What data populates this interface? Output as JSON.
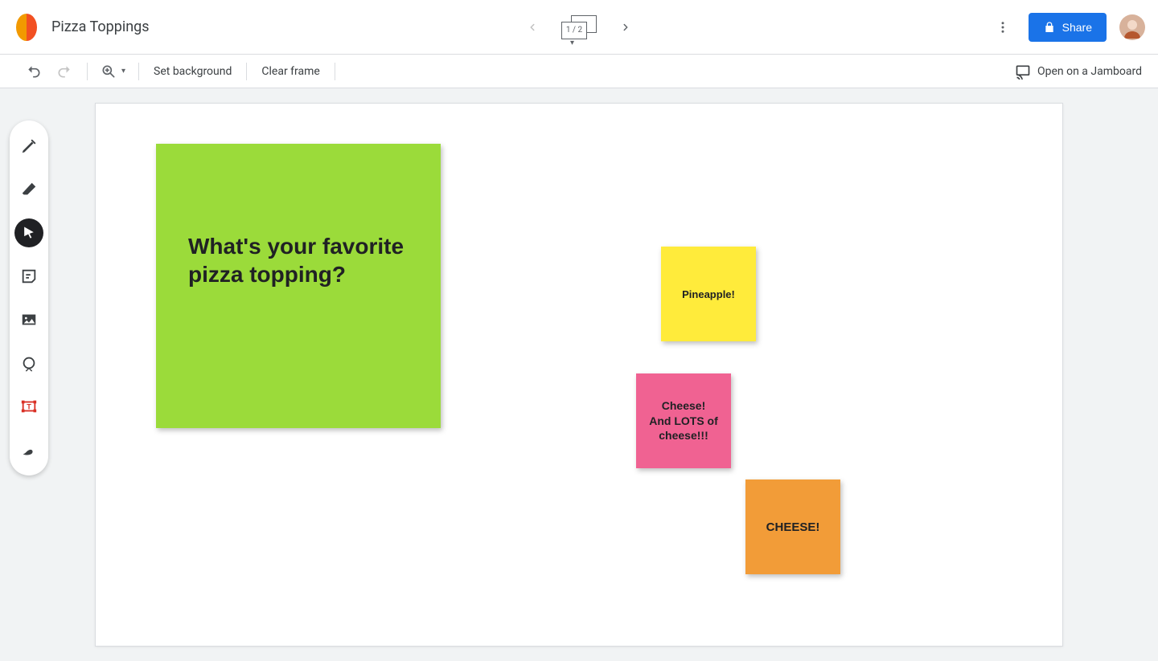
{
  "header": {
    "title": "Pizza Toppings",
    "frame_label": "1 / 2",
    "share_label": "Share"
  },
  "subbar": {
    "set_background": "Set background",
    "clear_frame": "Clear frame",
    "open_on_jamboard": "Open on a Jamboard"
  },
  "notes": {
    "prompt": "What's your favorite pizza topping?",
    "yellow": "Pineapple!",
    "pink": "Cheese!\nAnd LOTS of cheese!!!",
    "orange": "CHEESE!"
  }
}
